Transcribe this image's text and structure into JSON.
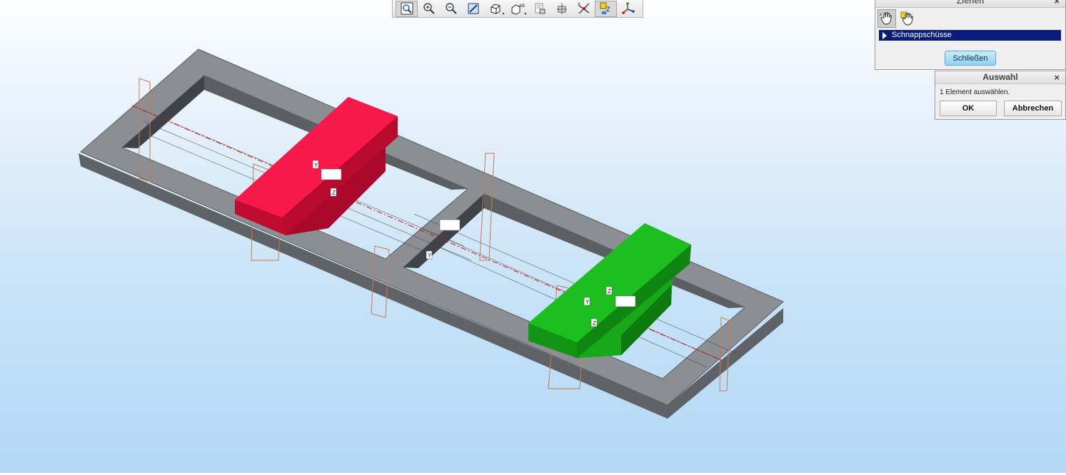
{
  "toolbar": {
    "buttons": [
      {
        "icon": "zoom-fit-icon"
      },
      {
        "icon": "zoom-in-icon"
      },
      {
        "icon": "zoom-out-icon"
      },
      {
        "icon": "repaint-icon"
      },
      {
        "icon": "display-style-icon"
      },
      {
        "icon": "saved-views-icon"
      },
      {
        "icon": "layers-icon"
      },
      {
        "icon": "spin-center-icon"
      },
      {
        "icon": "datum-display-icon"
      },
      {
        "icon": "annotation-display-icon"
      },
      {
        "icon": "csys-icon"
      }
    ]
  },
  "filter_panel": {
    "title": "Ziehen",
    "item_label": "Schnappschüsse",
    "close_button": "Schließen",
    "close_icon": "×"
  },
  "selection_dialog": {
    "title": "Auswahl",
    "prompt": "1 Element auswählen.",
    "ok_label": "OK",
    "cancel_label": "Abbrechen",
    "close_icon": "×"
  },
  "model": {
    "datum_labels": [
      "Y",
      "Z",
      "Y",
      "Z",
      "Y",
      "Z"
    ],
    "colors": {
      "frame_top": "#8a8e92",
      "frame_side": "#5f6368",
      "frame_inner": "#414549",
      "red_part": "#f0133e",
      "green_part": "#17b11b",
      "datum_plane": "#c87a4a",
      "axis": "#d01010"
    }
  }
}
